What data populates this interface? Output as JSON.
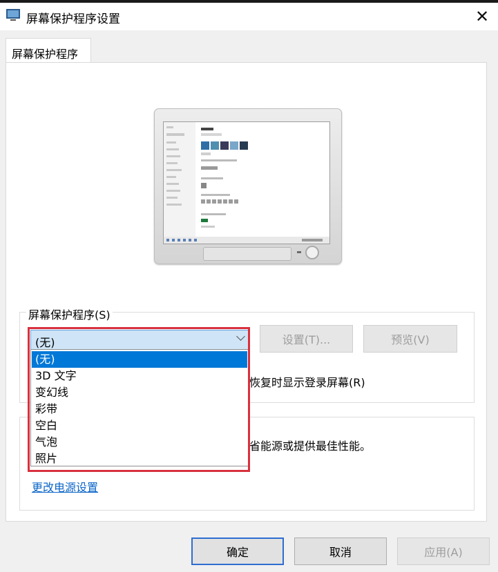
{
  "window": {
    "title": "屏幕保护程序设置",
    "close_glyph": "✕",
    "icon": "screensaver-app-icon"
  },
  "tab": {
    "label": "屏幕保护程序"
  },
  "screensaver": {
    "group_label": "屏幕保护程序(S)",
    "selected": "(无)",
    "settings_label": "设置(T)...",
    "preview_label": "预览(V)",
    "resume_text_partial": "恢复时显示登录屏幕(R)",
    "options": [
      "(无)",
      "3D 文字",
      "变幻线",
      "彩带",
      "空白",
      "气泡",
      "照片"
    ]
  },
  "power": {
    "text_partial": "省能源或提供最佳性能。",
    "link_label": "更改电源设置"
  },
  "footer": {
    "ok_label": "确定",
    "cancel_label": "取消",
    "apply_label": "应用(A)"
  },
  "colors": {
    "accent": "#0078d7",
    "highlight_frame": "#d9303e",
    "link": "#0a64c7"
  }
}
